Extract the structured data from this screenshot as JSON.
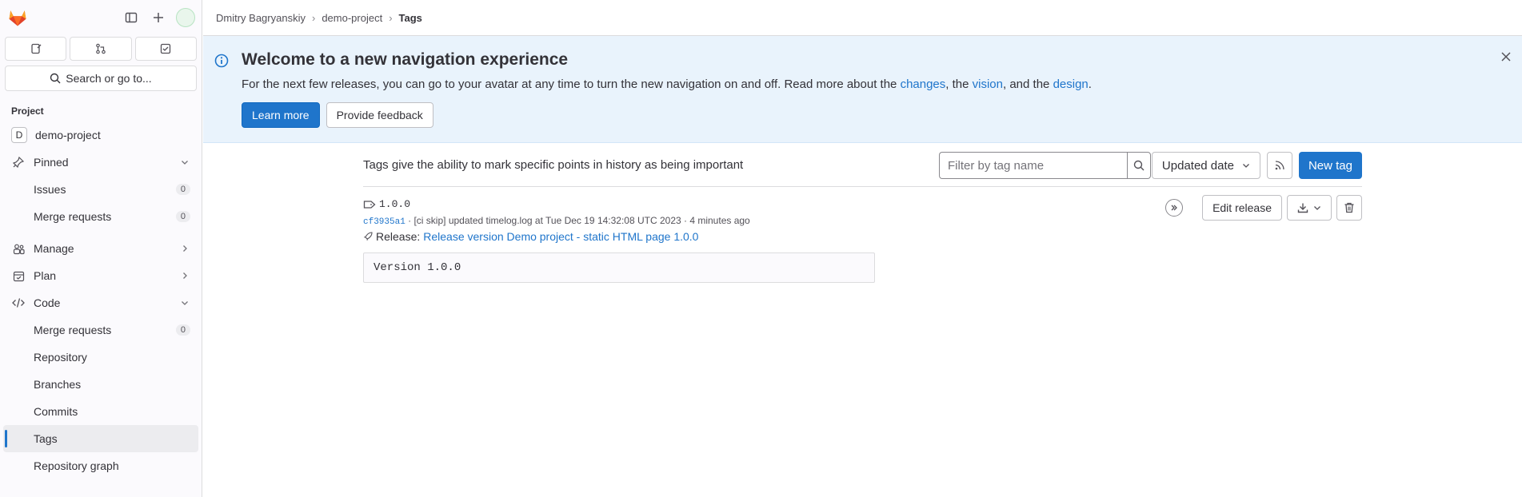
{
  "sidebar": {
    "search_label": "Search or go to...",
    "section_title": "Project",
    "project_name": "demo-project",
    "project_letter": "D",
    "pinned_label": "Pinned",
    "pinned_items": [
      {
        "label": "Issues",
        "count": "0"
      },
      {
        "label": "Merge requests",
        "count": "0"
      }
    ],
    "manage_label": "Manage",
    "plan_label": "Plan",
    "code_label": "Code",
    "code_items": [
      {
        "label": "Merge requests",
        "count": "0"
      },
      {
        "label": "Repository"
      },
      {
        "label": "Branches"
      },
      {
        "label": "Commits"
      },
      {
        "label": "Tags"
      },
      {
        "label": "Repository graph"
      }
    ]
  },
  "breadcrumb": {
    "user": "Dmitry Bagryanskiy",
    "project": "demo-project",
    "current": "Tags"
  },
  "banner": {
    "title": "Welcome to a new navigation experience",
    "text_before": "For the next few releases, you can go to your avatar at any time to turn the new navigation on and off. Read more about the ",
    "link_changes": "changes",
    "text_mid1": ", the ",
    "link_vision": "vision",
    "text_mid2": ", and the ",
    "link_design": "design",
    "text_end": ".",
    "learn_more": "Learn more",
    "feedback": "Provide feedback"
  },
  "toolbar": {
    "description": "Tags give the ability to mark specific points in history as being important",
    "filter_placeholder": "Filter by tag name",
    "sort_label": "Updated date",
    "new_tag": "New tag"
  },
  "tag": {
    "name": "1.0.0",
    "sha": "cf3935a1",
    "meta": " · [ci skip] updated timelog.log at Tue Dec 19 14:32:08 UTC 2023 · 4 minutes ago",
    "release_prefix": "Release:",
    "release_link": "Release version Demo project - static HTML page 1.0.0",
    "message": "Version 1.0.0",
    "edit_release": "Edit release"
  }
}
